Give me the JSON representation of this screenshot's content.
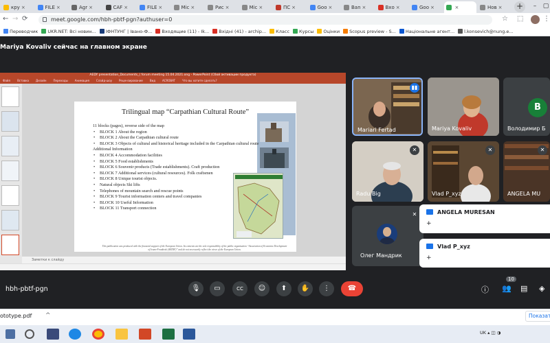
{
  "browser": {
    "tabs": [
      {
        "label": "кру",
        "color": "#fbbc04"
      },
      {
        "label": "FILE",
        "color": "#4285f4"
      },
      {
        "label": "Agr",
        "color": "#666666"
      },
      {
        "label": "CAF",
        "color": "#444444"
      },
      {
        "label": "FILE",
        "color": "#4285f4"
      },
      {
        "label": "Mic",
        "color": "#888888"
      },
      {
        "label": "Рис",
        "color": "#888888"
      },
      {
        "label": "Mic",
        "color": "#888888"
      },
      {
        "label": "ПС",
        "color": "#c0392b"
      },
      {
        "label": "Goo",
        "color": "#4285f4"
      },
      {
        "label": "Ban",
        "color": "#888888"
      },
      {
        "label": "Вхо",
        "color": "#d93025"
      },
      {
        "label": "Goo",
        "color": "#4285f4"
      },
      {
        "label": "",
        "color": "#34a853"
      },
      {
        "label": "Нов",
        "color": "#888888"
      }
    ],
    "url": "meet.google.com/hbh-pbtf-pgn?authuser=0",
    "bookmarks": [
      "Переводчик",
      "UKR.NET: Всі новин...",
      "ІФНТУНГ | Івано-Ф...",
      "Входящие (11) - Ik...",
      "Вхідні (41) - archip...",
      "Класс",
      "Курсы",
      "Оцінки",
      "Scopus preview - S...",
      "Національне агент...",
      "l.konsevich@nung.e..."
    ]
  },
  "meet": {
    "presenter_banner": "Mariya Kovaliv сейчас на главном экране",
    "meeting_code": "hbh-pbtf-pgn",
    "participant_count": "10",
    "participants": [
      {
        "name": "Mariari Fertad"
      },
      {
        "name": "Mariya Kovaliv"
      },
      {
        "name": "Володимир Б",
        "initial": "B"
      },
      {
        "name": "Radu Big"
      },
      {
        "name": "Vlad P_xyz"
      },
      {
        "name": "ANGELA MU"
      },
      {
        "name": "Олег Мандрик"
      }
    ],
    "chat_cards": [
      {
        "name": "ANGELA MURESAN",
        "action": "+"
      },
      {
        "name": "Vlad P_xyz",
        "action": "+"
      }
    ]
  },
  "powerpoint": {
    "window_title": "AEDY presentation_Documents_( forum meeting 15.04.2021.ong - PowerPoint (Сбой активации продукта)",
    "ribbon": [
      "Файл",
      "Вставка",
      "Дизайн",
      "Переходы",
      "Анимация",
      "Слайд-шоу",
      "Рецензирование",
      "Вид",
      "ACROBAT",
      "Что вы хотите сделать?"
    ],
    "notes_placeholder": "Заметки к слайду",
    "slide": {
      "title": "Trilingual map “Carpathian Cultural Route”",
      "lines": [
        {
          "text": "11 blocks (pages), reverse side of the map",
          "bullet": false
        },
        {
          "text": "BLOCK 1 About the region",
          "bullet": true
        },
        {
          "text": "BLOCK 2 About the Carpathian cultural route",
          "bullet": true
        },
        {
          "text": "BLOCK 3 Objects of cultural and historical heritage included in the Carpathian cultural route",
          "bullet": true
        },
        {
          "text": "Additional Information",
          "bullet": false
        },
        {
          "text": "BLOCK 4 Accommodation facilities",
          "bullet": true
        },
        {
          "text": "BLOCK 5 Food establishments",
          "bullet": true
        },
        {
          "text": "BLOCK 6 Souvenir products (Trade establishments). Craft production",
          "bullet": true
        },
        {
          "text": "BLOCK 7 Additional services (cultural resources). Folk craftsmen",
          "bullet": true
        },
        {
          "text": "BLOCK 8 Unique tourist objects.",
          "bullet": true
        },
        {
          "text": "Natural objects Ski lifts",
          "bullet": true
        },
        {
          "text": "Telephones of mountain search and rescue points",
          "bullet": true
        },
        {
          "text": "BLOCK 9 Tourist information centers and travel companies",
          "bullet": true
        },
        {
          "text": "BLOCK 10 Useful Information",
          "bullet": true
        },
        {
          "text": "BLOCK 11 Transport connection",
          "bullet": true
        }
      ],
      "footer": "This publication was produced with the financial support of the European Union. Its contents are the sole responsibility of the public organisation “Association of Economic Development of Ivano-Frankivsk (AEDIF)” and do not necessarily reflect the views of the European Union."
    }
  },
  "downloads": {
    "file": "ototype.pdf",
    "show_all": "Показат"
  },
  "taskbar": {
    "lang": "UK"
  }
}
